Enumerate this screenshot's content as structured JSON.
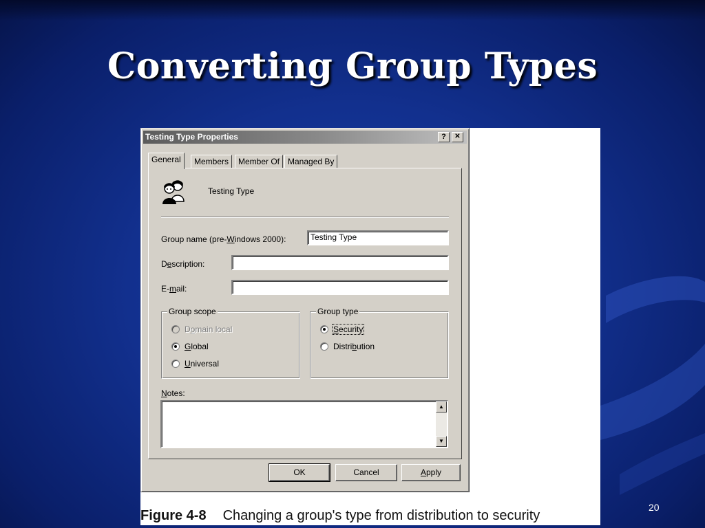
{
  "slide": {
    "title": "Converting Group Types",
    "number": "20"
  },
  "figure": {
    "label": "Figure 4-8",
    "caption": "Changing a group's type from distribution to security"
  },
  "dialog": {
    "title": "Testing Type Properties",
    "help_button": "?",
    "close_button": "✕",
    "tabs": [
      {
        "label": "General",
        "active": true
      },
      {
        "label": "Members"
      },
      {
        "label": "Member Of"
      },
      {
        "label": "Managed By"
      }
    ],
    "group_display_name": "Testing Type",
    "group_name_label": "Group name (pre-Windows 2000):",
    "group_name_value": "Testing Type",
    "description_label": "Description:",
    "description_value": "",
    "email_label": "E-mail:",
    "email_value": "",
    "group_scope": {
      "legend": "Group scope",
      "options": [
        {
          "label": "Domain local",
          "checked": false,
          "disabled": true
        },
        {
          "label": "Global",
          "checked": true
        },
        {
          "label": "Universal",
          "checked": false
        }
      ]
    },
    "group_type": {
      "legend": "Group type",
      "options": [
        {
          "label": "Security",
          "checked": true
        },
        {
          "label": "Distribution",
          "checked": false
        }
      ]
    },
    "notes_label": "Notes:",
    "notes_value": "",
    "buttons": {
      "ok": "OK",
      "cancel": "Cancel",
      "apply": "Apply"
    }
  },
  "colors": {
    "slide_background": "#12308e",
    "dialog_face": "#d4d0c8",
    "titlebar_text": "#ffffff"
  },
  "icons": {
    "group": "group-users-icon"
  }
}
